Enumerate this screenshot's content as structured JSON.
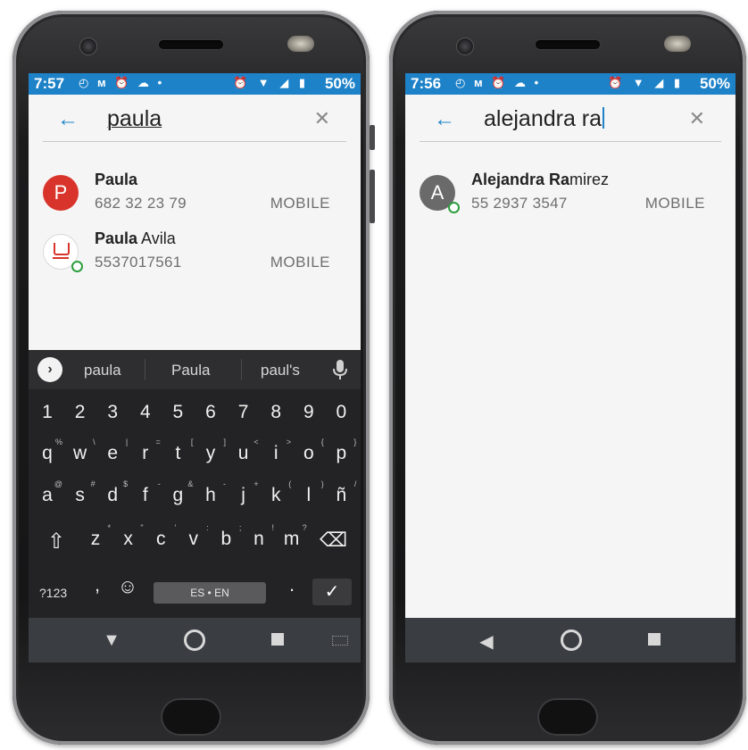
{
  "left": {
    "status": {
      "time": "7:57",
      "left_icons": "◴ ᴍ ⏰ ☁ •",
      "right_icons": "⏰ ▼ ◢ ▮",
      "battery": "50%"
    },
    "search": {
      "query": "paula"
    },
    "contacts": [
      {
        "initial": "P",
        "name_bold": "Paula",
        "name_rest": "",
        "number": "682 32 23 79",
        "type": "MOBILE",
        "avatar": "red-letter"
      },
      {
        "initial": "",
        "name_bold": "Paula",
        "name_rest": " Avila",
        "number": "5537017561",
        "type": "MOBILE",
        "avatar": "logo"
      }
    ],
    "keyboard": {
      "suggestions": [
        "paula",
        "Paula",
        "paul's"
      ],
      "number_row": [
        "1",
        "2",
        "3",
        "4",
        "5",
        "6",
        "7",
        "8",
        "9",
        "0"
      ],
      "row1": [
        {
          "k": "q",
          "s": "%"
        },
        {
          "k": "w",
          "s": "\\"
        },
        {
          "k": "e",
          "s": "|"
        },
        {
          "k": "r",
          "s": "="
        },
        {
          "k": "t",
          "s": "["
        },
        {
          "k": "y",
          "s": "]"
        },
        {
          "k": "u",
          "s": "<"
        },
        {
          "k": "i",
          "s": ">"
        },
        {
          "k": "o",
          "s": "{"
        },
        {
          "k": "p",
          "s": "}"
        }
      ],
      "row2": [
        {
          "k": "a",
          "s": "@"
        },
        {
          "k": "s",
          "s": "#"
        },
        {
          "k": "d",
          "s": "$"
        },
        {
          "k": "f",
          "s": "-"
        },
        {
          "k": "g",
          "s": "&"
        },
        {
          "k": "h",
          "s": "-"
        },
        {
          "k": "j",
          "s": "+"
        },
        {
          "k": "k",
          "s": "("
        },
        {
          "k": "l",
          "s": ")"
        },
        {
          "k": "ñ",
          "s": "/"
        }
      ],
      "row3": [
        {
          "k": "z",
          "s": "*"
        },
        {
          "k": "x",
          "s": "\""
        },
        {
          "k": "c",
          "s": "'"
        },
        {
          "k": "v",
          "s": ":"
        },
        {
          "k": "b",
          "s": ";"
        },
        {
          "k": "n",
          "s": "!"
        },
        {
          "k": "m",
          "s": "?"
        }
      ],
      "symbols_label": "?123",
      "comma": ",",
      "space_label": "ES • EN",
      "period": ".",
      "shift_icon": "⇧",
      "backspace_icon": "⌫",
      "emoji_icon": "☺",
      "enter_icon": "✓"
    }
  },
  "right": {
    "status": {
      "time": "7:56",
      "left_icons": "◴ ᴍ ⏰ ☁ •",
      "right_icons": "⏰ ▼ ◢ ▮",
      "battery": "50%"
    },
    "search": {
      "query": "alejandra ra"
    },
    "contacts": [
      {
        "initial": "A",
        "name_bold": "Alejandra Ra",
        "name_rest": "mirez",
        "number": "55 2937 3547",
        "type": "MOBILE",
        "avatar": "grey-letter"
      }
    ]
  },
  "colors": {
    "accent": "#1e82c8",
    "avatar_red": "#d9342b",
    "avatar_grey": "#6a6a6a",
    "online": "#2e9e3e",
    "keyboard_bg": "#232325"
  }
}
